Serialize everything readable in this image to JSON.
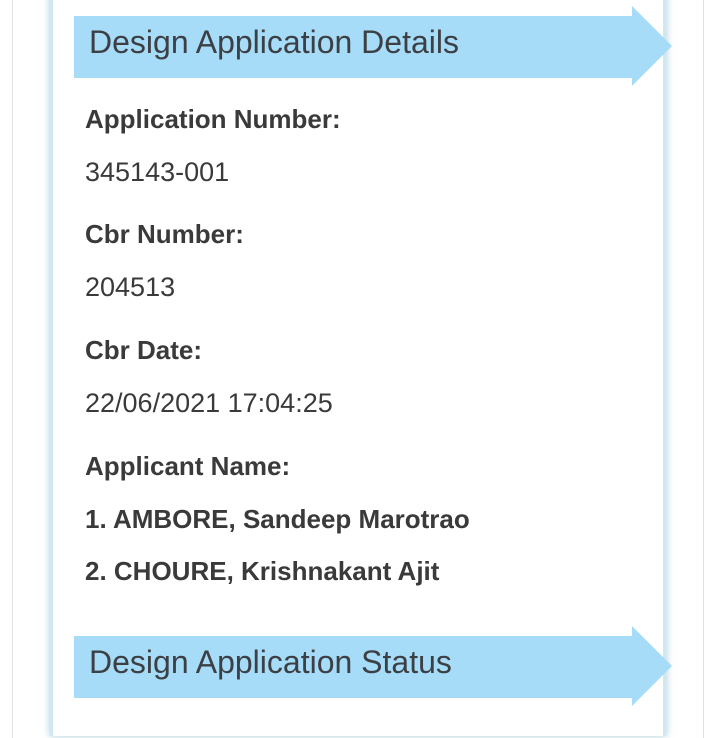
{
  "sections": {
    "details_title": "Design Application Details",
    "status_title": "Design Application Status"
  },
  "fields": [
    {
      "label": "Application Number:",
      "value": "345143-001"
    },
    {
      "label": "Cbr Number:",
      "value": "204513"
    },
    {
      "label": "Cbr Date:",
      "value": "22/06/2021 17:04:25"
    }
  ],
  "applicants": {
    "label": "Applicant Name:",
    "names": [
      "1. AMBORE, Sandeep Marotrao",
      "2. CHOURE, Krishnakant Ajit"
    ]
  },
  "colors": {
    "banner": "#a6dcf8",
    "banner_text": "#3c3f44",
    "card_border": "#cfe8f2"
  }
}
